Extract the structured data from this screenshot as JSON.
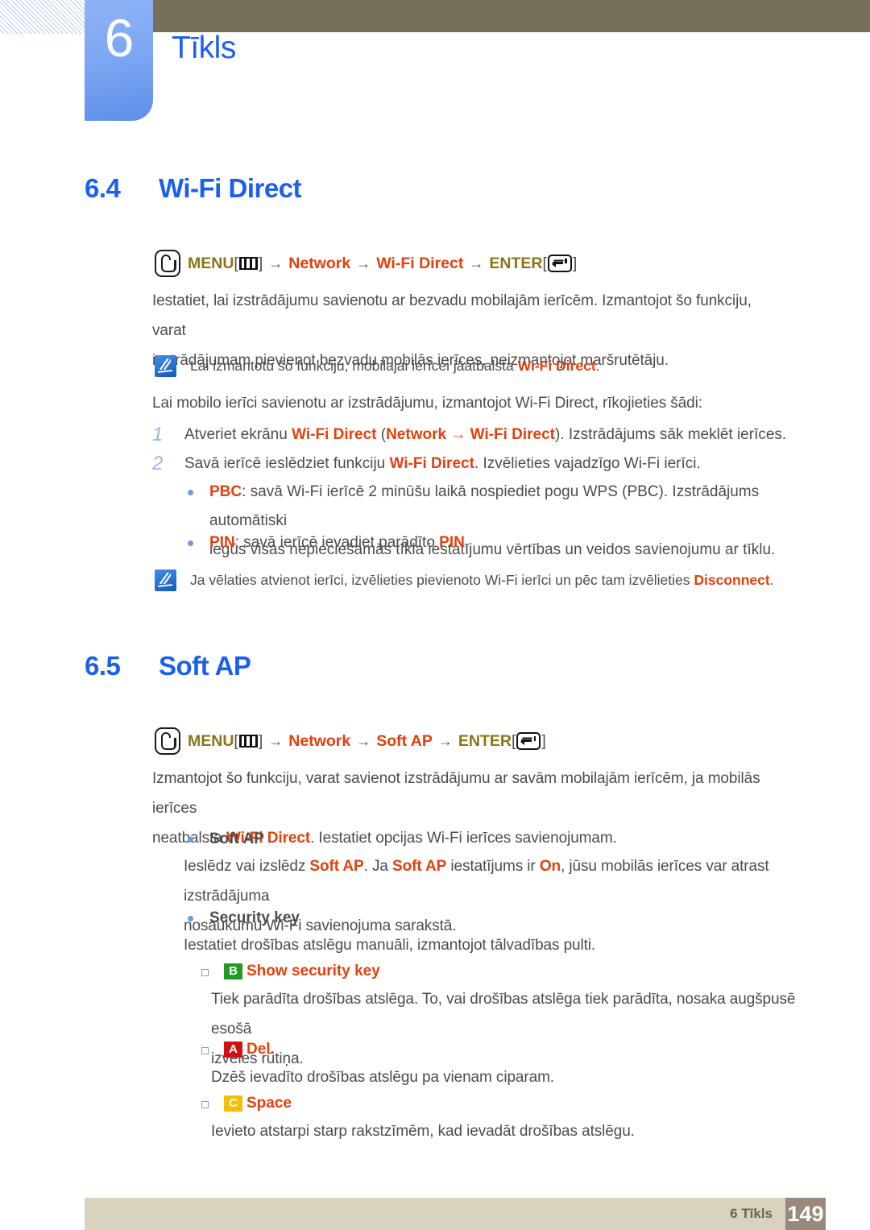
{
  "header": {
    "chapter_number": "6",
    "chapter_title": "Tīkls"
  },
  "sections": [
    {
      "number": "6.4",
      "title": "Wi-Fi Direct",
      "menu_path": {
        "icon": "remote-button-icon",
        "menu_label": "MENU",
        "menu_glyph": "menu-bars-glyph",
        "arrow": "→",
        "item1": "Network",
        "item2": "Wi-Fi Direct",
        "enter_label": "ENTER",
        "enter_glyph": "enter-return-glyph",
        "bracket_open": "[",
        "bracket_close": "]"
      }
    },
    {
      "number": "6.5",
      "title": "Soft AP",
      "menu_path": {
        "icon": "remote-button-icon",
        "menu_label": "MENU",
        "menu_glyph": "menu-bars-glyph",
        "arrow": "→",
        "item1": "Network",
        "item2": "Soft AP",
        "enter_label": "ENTER",
        "enter_glyph": "enter-return-glyph",
        "bracket_open": "[",
        "bracket_close": "]"
      }
    }
  ],
  "wifi_direct": {
    "intro_line1": "Iestatiet, lai izstrādājumu savienotu ar bezvadu mobilajām ierīcēm. Izmantojot šo funkciju, varat",
    "intro_line2": "izstrādājumam pievienot bezvadu mobilās ierīces, neizmantojot maršrutētāju.",
    "note1_prefix": "Lai izmantotu šo funkciju, mobilajai ierīcei jāatbalsta ",
    "note1_highlight": "Wi-Fi Direct",
    "note1_suffix": ".",
    "steps_intro": "Lai mobilo ierīci savienotu ar izstrādājumu, izmantojot Wi-Fi Direct, rīkojieties šādi:",
    "steps": [
      {
        "number": "1",
        "p1": "Atveriet ekrānu ",
        "h1": "Wi-Fi Direct",
        "p2": " (",
        "h2": "Network",
        "p3": " → ",
        "h3": "Wi-Fi Direct",
        "p4": "). Izstrādājums sāk meklēt ierīces."
      },
      {
        "number": "2",
        "p1": "Savā ierīcē ieslēdziet funkciju ",
        "h1": "Wi-Fi Direct",
        "p2": ". Izvēlieties vajadzīgo Wi-Fi ierīci.",
        "h2": "",
        "p3": "",
        "h3": "",
        "p4": ""
      }
    ],
    "bullets": [
      {
        "marker": "•",
        "label": "PBC",
        "line1_rest": ": savā Wi-Fi ierīcē 2 minūšu laikā nospiediet pogu WPS (PBC). Izstrādājums automātiski",
        "line2": "iegūs visas nepieciešamās tīkla iestatījumu vērtības un veidos savienojumu ar tīklu."
      },
      {
        "marker": "•",
        "label": "PIN",
        "line1_rest": ": savā ierīcē ievadiet parādīto ",
        "line1_highlight": "PIN",
        "line1_end": ".",
        "line2": ""
      }
    ],
    "note2_prefix": "Ja vēlaties atvienot ierīci, izvēlieties pievienoto Wi-Fi ierīci un pēc tam izvēlieties ",
    "note2_highlight": "Disconnect",
    "note2_suffix": "."
  },
  "soft_ap": {
    "intro_line1": "Izmantojot šo funkciju, varat savienot izstrādājumu ar savām mobilajām ierīcēm, ja mobilās ierīces",
    "intro_line2_p1": "neatbalsta ",
    "intro_line2_h1": "Wi-Fi Direct",
    "intro_line2_p2": ". Iestatiet opcijas Wi-Fi ierīces savienojumam.",
    "bullet1": {
      "marker": "•",
      "label": "Soft AP",
      "desc_line1_p1": "Ieslēdz vai izslēdz ",
      "desc_line1_h1": "Soft AP",
      "desc_line1_p2": ". Ja ",
      "desc_line1_h2": "Soft AP",
      "desc_line1_p3": " iestatījums ir ",
      "desc_line1_h3": "On",
      "desc_line1_p4": ", jūsu mobilās ierīces var atrast izstrādājuma",
      "desc_line2": "nosaukumu Wi-Fi savienojuma sarakstā."
    },
    "bullet2": {
      "marker": "•",
      "label": "Security key",
      "desc": "Iestatiet drošības atslēgu manuāli, izmantojot tālvadības pulti."
    },
    "subitems": [
      {
        "marker": "□",
        "badge": "B",
        "badge_color": "#249a26",
        "label": "Show security key",
        "desc_line1": "Tiek parādīta drošības atslēga. To, vai drošības atslēga tiek parādīta, nosaka augšpusē esošā",
        "desc_line2": "izvēles rūtiņa."
      },
      {
        "marker": "□",
        "badge": "A",
        "badge_color": "#cf1116",
        "label": "Del.",
        "desc_line1": "Dzēš ievadīto drošības atslēgu pa vienam ciparam.",
        "desc_line2": ""
      },
      {
        "marker": "□",
        "badge": "C",
        "badge_color": "#f5bf06",
        "label": "Space",
        "desc_line1": "Ievieto atstarpi starp rakstzīmēm, kad ievadāt drošības atslēgu.",
        "desc_line2": ""
      }
    ]
  },
  "footer": {
    "chapter_ref": "6 Tīkls",
    "page_number": "149"
  },
  "colors": {
    "heading_blue": "#1b5ff0",
    "highlight_red": "#e2400d",
    "menu_gold": "#8c7415",
    "body_gray": "#4d4d4d",
    "olive_bar": "#74705a",
    "tab_blue": "#7ea8f4",
    "footer_bar": "#d8d3bf",
    "footer_page_box": "#99897c"
  }
}
